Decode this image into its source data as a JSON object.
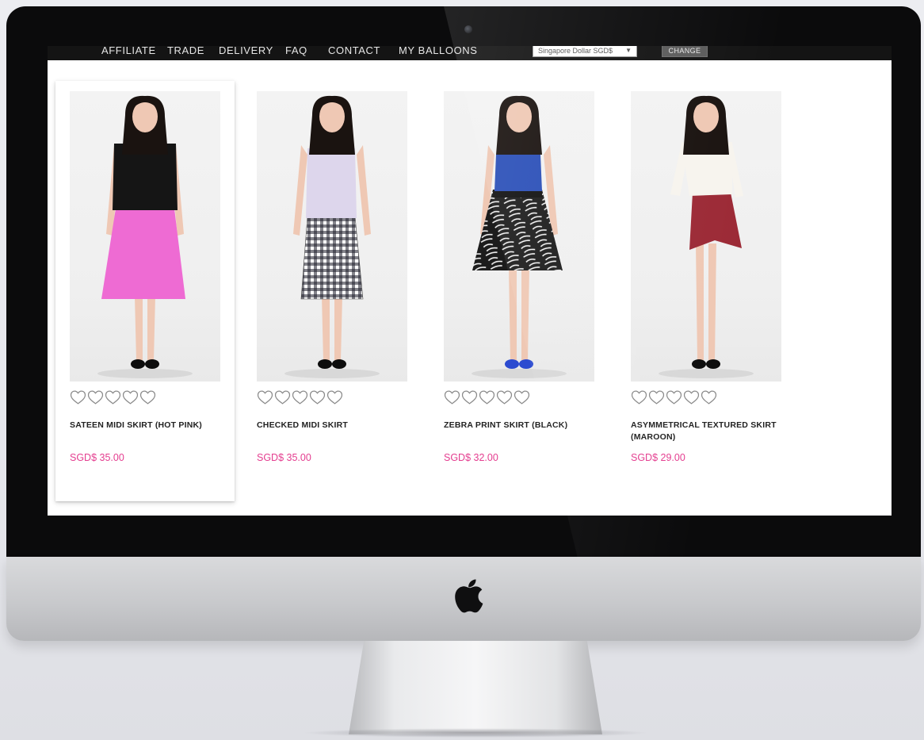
{
  "nav": {
    "items": [
      "AFFILIATE",
      "TRADE",
      "DELIVERY",
      "FAQ",
      "CONTACT",
      "MY BALLOONS"
    ],
    "currency_select": "Singapore Dollar SGD$",
    "change_button": "CHANGE"
  },
  "products": [
    {
      "name": "SATEEN MIDI SKIRT (HOT PINK)",
      "price": "SGD$ 35.00",
      "rating_hearts": 5,
      "top_color": "#151515",
      "skirt_color": "#ee6bd3",
      "skirt_pattern": "solid"
    },
    {
      "name": "CHECKED MIDI SKIRT",
      "price": "SGD$ 35.00",
      "rating_hearts": 5,
      "top_color": "#ddd6ec",
      "skirt_color": "#ffffff",
      "skirt_pattern": "gingham"
    },
    {
      "name": "ZEBRA PRINT SKIRT (BLACK)",
      "price": "SGD$ 32.00",
      "rating_hearts": 5,
      "top_color": "#2a4fb8",
      "skirt_color": "#1c1c1c",
      "skirt_pattern": "zebra"
    },
    {
      "name": "ASYMMETRICAL TEXTURED SKIRT (MAROON)",
      "price": "SGD$ 29.00",
      "rating_hearts": 5,
      "top_color": "#f7f4ee",
      "skirt_color": "#9c2a36",
      "skirt_pattern": "solid"
    }
  ],
  "colors": {
    "price": "#e43d8f",
    "nav_background": "#141414",
    "bezel": "#0b0b0c"
  },
  "icons": {
    "rating": "heart-outline-icon",
    "brand": "apple-logo-icon"
  }
}
